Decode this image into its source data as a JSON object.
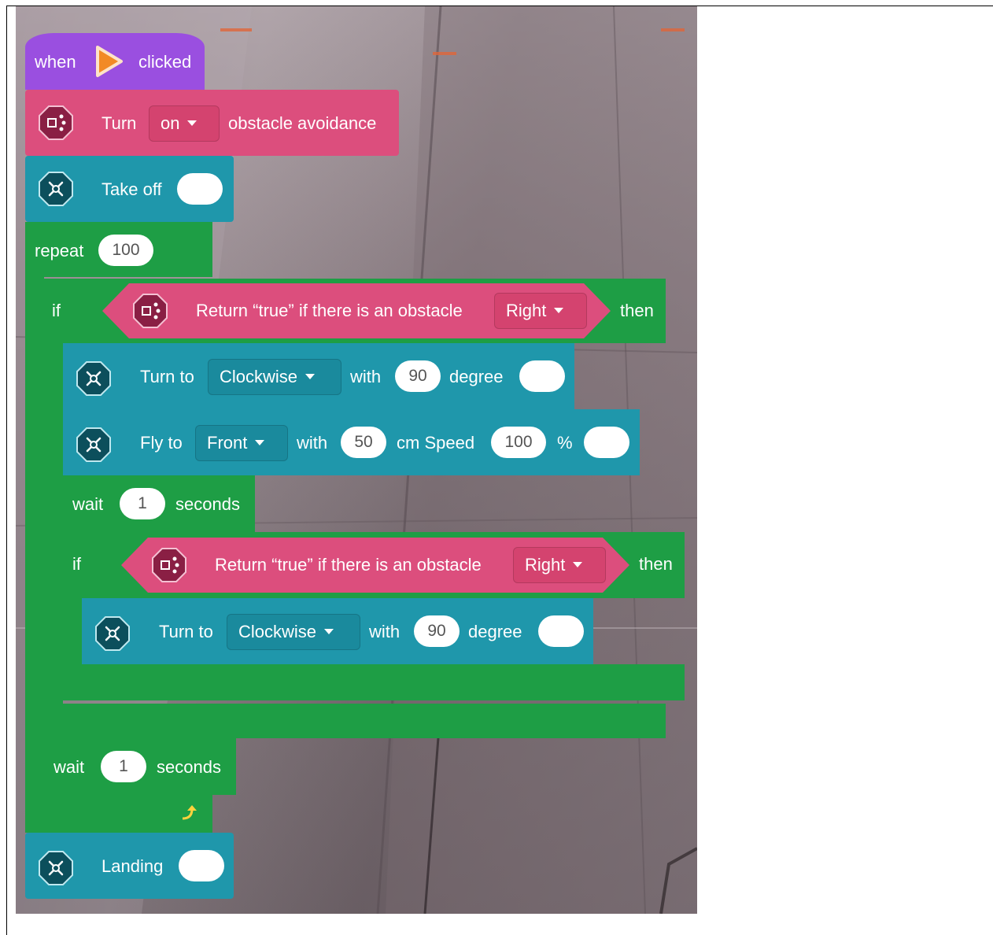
{
  "hat": {
    "when": "when",
    "clicked": "clicked"
  },
  "avoidance": {
    "turn": "Turn",
    "state": "on",
    "rest": "obstacle avoidance"
  },
  "takeoff": {
    "label": "Take off"
  },
  "repeat": {
    "label": "repeat",
    "count": "100"
  },
  "if1": {
    "if": "if",
    "cond": "Return “true” if there is an obstacle",
    "dir": "Right",
    "then": "then"
  },
  "turn1": {
    "label": "Turn to",
    "dir": "Clockwise",
    "with": "with",
    "deg": "90",
    "unit": "degree"
  },
  "fly": {
    "label": "Fly to",
    "dir": "Front",
    "with": "with",
    "dist": "50",
    "unit": "cm Speed",
    "speed": "100",
    "pct": "%"
  },
  "wait1": {
    "label": "wait",
    "value": "1",
    "unit": "seconds"
  },
  "if2": {
    "if": "if",
    "cond": "Return “true” if there is an obstacle",
    "dir": "Right",
    "then": "then"
  },
  "turn2": {
    "label": "Turn to",
    "dir": "Clockwise",
    "with": "with",
    "deg": "90",
    "unit": "degree"
  },
  "wait2": {
    "label": "wait",
    "value": "1",
    "unit": "seconds"
  },
  "landing": {
    "label": "Landing"
  },
  "colors": {
    "event": "#9a4fe0",
    "sensor": "#dc4e7d",
    "drone": "#1f97ab",
    "control": "#1e9e45"
  },
  "icons": [
    "play-icon",
    "sensor-icon",
    "drone-icon",
    "loop-arrow-icon"
  ]
}
